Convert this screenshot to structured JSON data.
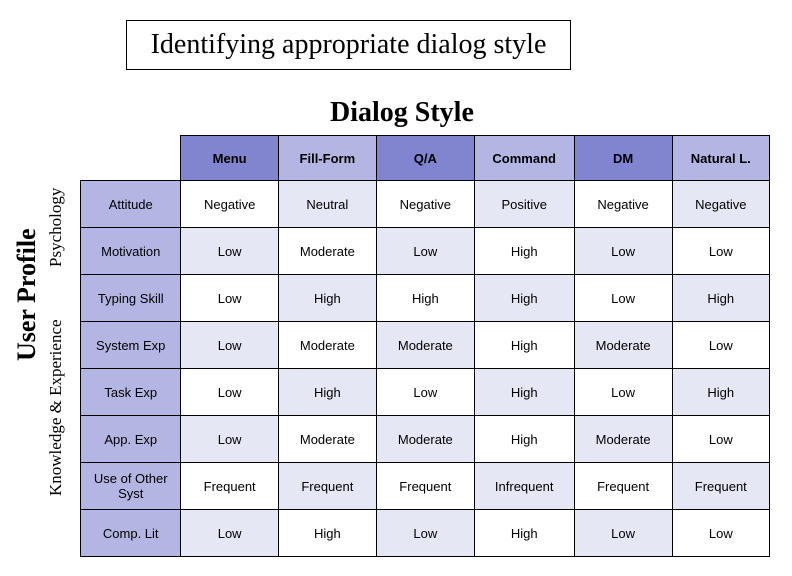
{
  "title": "Identifying appropriate dialog style",
  "section": "Dialog Style",
  "vert_main": "User Profile",
  "vert_top": "Psychology",
  "vert_bottom": "Knowledge & Experience",
  "columns": [
    "Menu",
    "Fill-Form",
    "Q/A",
    "Command",
    "DM",
    "Natural L."
  ],
  "rows": [
    {
      "label": "Attitude",
      "cells": [
        "Negative",
        "Neutral",
        "Negative",
        "Positive",
        "Negative",
        "Negative"
      ]
    },
    {
      "label": "Motivation",
      "cells": [
        "Low",
        "Moderate",
        "Low",
        "High",
        "Low",
        "Low"
      ]
    },
    {
      "label": "Typing Skill",
      "cells": [
        "Low",
        "High",
        "High",
        "High",
        "Low",
        "High"
      ]
    },
    {
      "label": "System Exp",
      "cells": [
        "Low",
        "Moderate",
        "Moderate",
        "High",
        "Moderate",
        "Low"
      ]
    },
    {
      "label": "Task Exp",
      "cells": [
        "Low",
        "High",
        "Low",
        "High",
        "Low",
        "High"
      ]
    },
    {
      "label": "App. Exp",
      "cells": [
        "Low",
        "Moderate",
        "Moderate",
        "High",
        "Moderate",
        "Low"
      ]
    },
    {
      "label": "Use of Other Syst",
      "cells": [
        "Frequent",
        "Frequent",
        "Frequent",
        "Infrequent",
        "Frequent",
        "Frequent"
      ]
    },
    {
      "label": "Comp. Lit",
      "cells": [
        "Low",
        "High",
        "Low",
        "High",
        "Low",
        "Low"
      ]
    }
  ],
  "chart_data": {
    "type": "table",
    "title": "Dialog Style",
    "columns": [
      "Menu",
      "Fill-Form",
      "Q/A",
      "Command",
      "DM",
      "Natural L."
    ],
    "rows": [
      "Attitude",
      "Motivation",
      "Typing Skill",
      "System Exp",
      "Task Exp",
      "App. Exp",
      "Use of Other Syst",
      "Comp. Lit"
    ],
    "values": [
      [
        "Negative",
        "Neutral",
        "Negative",
        "Positive",
        "Negative",
        "Negative"
      ],
      [
        "Low",
        "Moderate",
        "Low",
        "High",
        "Low",
        "Low"
      ],
      [
        "Low",
        "High",
        "High",
        "High",
        "Low",
        "High"
      ],
      [
        "Low",
        "Moderate",
        "Moderate",
        "High",
        "Moderate",
        "Low"
      ],
      [
        "Low",
        "High",
        "Low",
        "High",
        "Low",
        "High"
      ],
      [
        "Low",
        "Moderate",
        "Moderate",
        "High",
        "Moderate",
        "Low"
      ],
      [
        "Frequent",
        "Frequent",
        "Frequent",
        "Infrequent",
        "Frequent",
        "Frequent"
      ],
      [
        "Low",
        "High",
        "Low",
        "High",
        "Low",
        "Low"
      ]
    ],
    "row_groups": {
      "Psychology": [
        "Attitude",
        "Motivation",
        "Typing Skill"
      ],
      "Knowledge & Experience": [
        "System Exp",
        "Task Exp",
        "App. Exp",
        "Use of Other Syst",
        "Comp. Lit"
      ]
    }
  }
}
